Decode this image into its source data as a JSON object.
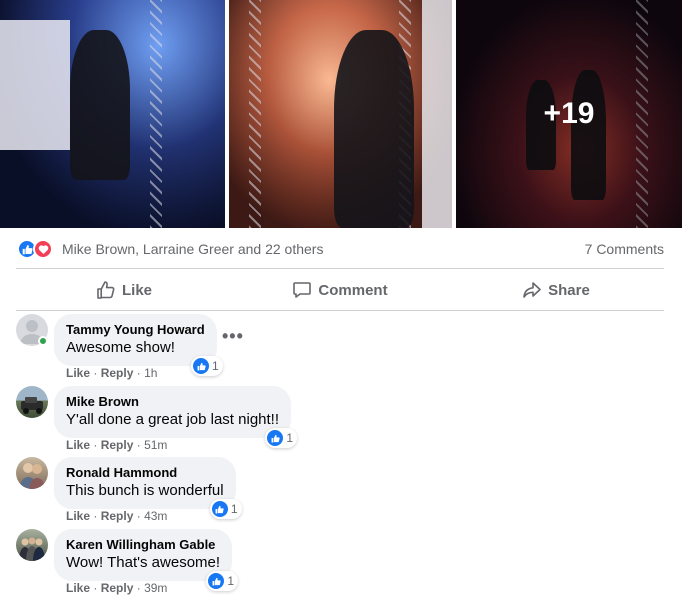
{
  "photos": {
    "more_count": "+19"
  },
  "reactions": {
    "names": "Mike Brown, Larraine Greer and 22 others",
    "comments_count": "7 Comments"
  },
  "actions": {
    "like": "Like",
    "comment": "Comment",
    "share": "Share"
  },
  "comments": [
    {
      "author": "Tammy Young Howard",
      "text": "Awesome show!",
      "reaction_count": "1",
      "like": "Like",
      "reply": "Reply",
      "sep": "·",
      "time": "1h"
    },
    {
      "author": "Mike Brown",
      "text": "Y'all done a great job last night!!",
      "reaction_count": "1",
      "like": "Like",
      "reply": "Reply",
      "sep": "·",
      "time": "51m"
    },
    {
      "author": "Ronald Hammond",
      "text": "This bunch is wonderful",
      "reaction_count": "1",
      "like": "Like",
      "reply": "Reply",
      "sep": "·",
      "time": "43m"
    },
    {
      "author": "Karen Willingham Gable",
      "text": "Wow! That's awesome!",
      "reaction_count": "1",
      "like": "Like",
      "reply": "Reply",
      "sep": "·",
      "time": "39m"
    }
  ],
  "colors": {
    "accent": "#1877f2",
    "love": "#f33e58",
    "muted": "#65676b",
    "bubble": "#f0f2f5",
    "online": "#31a24c"
  }
}
